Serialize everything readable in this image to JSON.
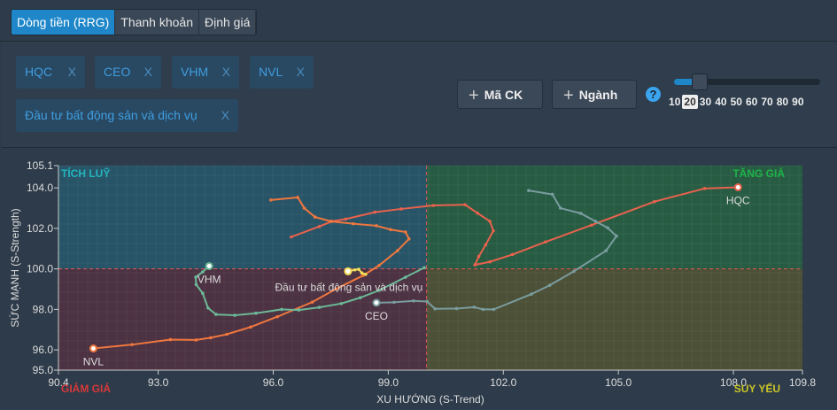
{
  "tabs": [
    {
      "label": "Dòng tiền (RRG)",
      "active": true
    },
    {
      "label": "Thanh khoản",
      "active": false
    },
    {
      "label": "Định giá",
      "active": false
    }
  ],
  "tags": [
    {
      "label": "HQC",
      "remove": "X"
    },
    {
      "label": "CEO",
      "remove": "X"
    },
    {
      "label": "VHM",
      "remove": "X"
    },
    {
      "label": "NVL",
      "remove": "X"
    },
    {
      "label": "Đầu tư bất động sản và dịch vụ",
      "remove": "X"
    }
  ],
  "buttons": {
    "add_stock": "Mã CK",
    "add_sector": "Ngành",
    "plus": "+",
    "help": "?"
  },
  "slider": {
    "ticks": [
      "10",
      "20",
      "30",
      "40",
      "50",
      "60",
      "70",
      "80",
      "90"
    ],
    "value": 20,
    "min": 10,
    "max": 90
  },
  "chart_data": {
    "type": "scatter",
    "xlabel": "XU HƯỚNG (S-Trend)",
    "ylabel": "SỨC MẠNH (S-Strength)",
    "xlim": [
      90.4,
      109.8
    ],
    "ylim": [
      95.0,
      105.1
    ],
    "xticks": [
      "90.4",
      "93.0",
      "96.0",
      "99.0",
      "102.0",
      "105.0",
      "108.0",
      "109.8"
    ],
    "yticks": [
      "95.0",
      "96.0",
      "98.0",
      "100.0",
      "102.0",
      "104.0",
      "105.1"
    ],
    "center": [
      100,
      100
    ],
    "quadrants": {
      "top_left": "TÍCH LUỸ",
      "top_right": "TĂNG GIÁ",
      "bottom_left": "GIẢM GIÁ",
      "bottom_right": "SUY YẾU"
    },
    "quadrant_colors": {
      "top_left": "#275466",
      "top_right": "#275c43",
      "bottom_left": "#4c3242",
      "bottom_right": "#4c5036",
      "tl_text": "#23b5c0",
      "tr_text": "#1fb34a",
      "bl_text": "#d63a3a",
      "br_text": "#c9c526"
    },
    "series": [
      {
        "name": "HQC",
        "color": "#e9624e",
        "points": [
          [
            96.47,
            101.58
          ],
          [
            97.2,
            102.09
          ],
          [
            97.53,
            102.35
          ],
          [
            97.89,
            102.46
          ],
          [
            98.65,
            102.8
          ],
          [
            99.34,
            102.96
          ],
          [
            100.18,
            103.13
          ],
          [
            101.0,
            103.17
          ],
          [
            101.33,
            102.75
          ],
          [
            101.65,
            102.35
          ],
          [
            101.74,
            101.88
          ],
          [
            101.54,
            101.19
          ],
          [
            101.36,
            100.61
          ],
          [
            101.26,
            100.2
          ],
          [
            101.65,
            100.35
          ],
          [
            102.24,
            100.71
          ],
          [
            103.1,
            101.33
          ],
          [
            104.3,
            102.16
          ],
          [
            105.94,
            103.32
          ],
          [
            107.25,
            103.97
          ],
          [
            108.12,
            104.03
          ]
        ]
      },
      {
        "name": "NVL",
        "color": "#f0773f",
        "points": [
          [
            95.94,
            103.4
          ],
          [
            96.64,
            103.53
          ],
          [
            96.81,
            103.0
          ],
          [
            97.09,
            102.56
          ],
          [
            97.5,
            102.35
          ],
          [
            98.09,
            102.23
          ],
          [
            98.69,
            102.13
          ],
          [
            99.06,
            101.94
          ],
          [
            99.45,
            101.82
          ],
          [
            99.54,
            101.48
          ],
          [
            99.24,
            100.9
          ],
          [
            98.76,
            100.17
          ],
          [
            98.34,
            99.67
          ],
          [
            97.64,
            99.01
          ],
          [
            97.02,
            98.36
          ],
          [
            96.11,
            97.64
          ],
          [
            95.41,
            97.13
          ],
          [
            94.79,
            96.77
          ],
          [
            94.37,
            96.6
          ],
          [
            93.99,
            96.49
          ],
          [
            93.32,
            96.51
          ],
          [
            92.32,
            96.26
          ],
          [
            91.31,
            96.07
          ]
        ]
      },
      {
        "name": "CEO",
        "color": "#7a9c9f",
        "points": [
          [
            102.66,
            103.87
          ],
          [
            103.28,
            103.68
          ],
          [
            103.49,
            103.0
          ],
          [
            104.02,
            102.74
          ],
          [
            104.4,
            102.35
          ],
          [
            104.72,
            102.03
          ],
          [
            104.95,
            101.62
          ],
          [
            104.68,
            100.9
          ],
          [
            103.84,
            99.88
          ],
          [
            103.21,
            99.19
          ],
          [
            102.73,
            98.75
          ],
          [
            101.75,
            98.0
          ],
          [
            101.47,
            98.0
          ],
          [
            101.24,
            98.11
          ],
          [
            100.78,
            98.04
          ],
          [
            100.22,
            98.03
          ],
          [
            100.01,
            98.39
          ],
          [
            99.66,
            98.42
          ],
          [
            99.15,
            98.35
          ],
          [
            98.69,
            98.33
          ]
        ]
      },
      {
        "name": "VHM",
        "color": "#6cb898",
        "points": [
          [
            99.94,
            100.06
          ],
          [
            99.45,
            99.59
          ],
          [
            98.76,
            98.94
          ],
          [
            98.27,
            98.58
          ],
          [
            97.78,
            98.29
          ],
          [
            97.2,
            98.1
          ],
          [
            96.67,
            97.97
          ],
          [
            96.22,
            98.0
          ],
          [
            95.55,
            97.81
          ],
          [
            95.0,
            97.71
          ],
          [
            94.51,
            97.75
          ],
          [
            94.3,
            98.07
          ],
          [
            94.16,
            98.8
          ],
          [
            93.99,
            99.23
          ],
          [
            93.98,
            99.59
          ],
          [
            94.16,
            99.85
          ],
          [
            94.33,
            100.14
          ]
        ]
      },
      {
        "name": "Đầu tư bất động sản và dịch vụ",
        "color": "#f2e05a",
        "points": [
          [
            98.41,
            99.73
          ],
          [
            98.31,
            99.8
          ],
          [
            98.23,
            99.98
          ],
          [
            98.13,
            99.95
          ],
          [
            97.95,
            99.88
          ]
        ]
      }
    ]
  }
}
